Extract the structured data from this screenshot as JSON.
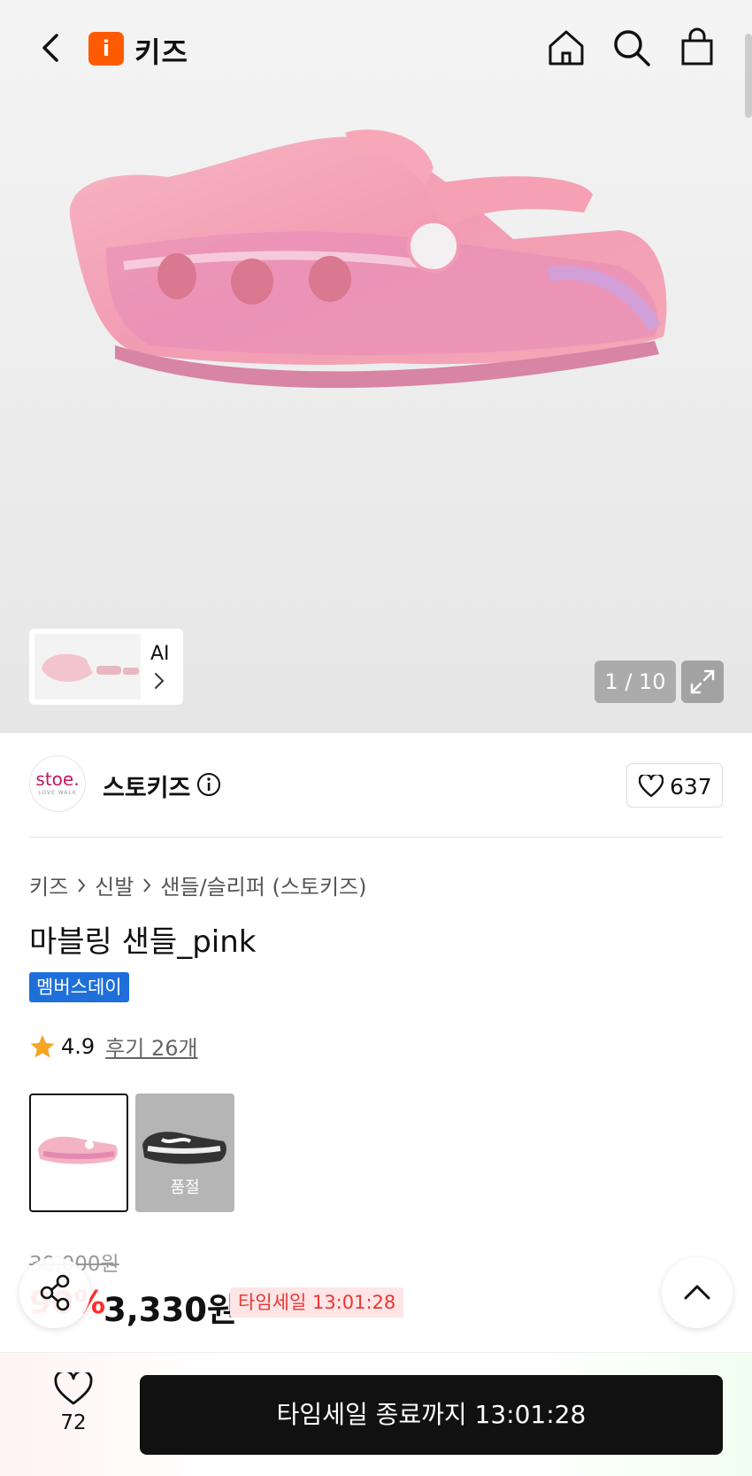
{
  "header": {
    "logo_text": "i",
    "title": "키즈",
    "icons": [
      "back-icon",
      "home-icon",
      "search-icon",
      "shopping-bag-icon"
    ]
  },
  "gallery": {
    "ai_label": "AI",
    "counter": "1 / 10"
  },
  "seller": {
    "logo_text": "stoe.",
    "logo_sub": "LOVE WALK",
    "name": "스토키즈",
    "likes": "637"
  },
  "breadcrumb": [
    "키즈",
    "신발",
    "샌들/슬리퍼 (스토키즈)"
  ],
  "product": {
    "title": "마블링 샌들_pink",
    "badge": "멤버스데이",
    "rating": "4.9",
    "reviews": "후기 26개",
    "soldout_label": "품절"
  },
  "price": {
    "original": "30,000원",
    "discount": "90%",
    "sale": "3,330원",
    "timesale_tag": "타임세일 13:01:28"
  },
  "bottom_bar": {
    "wish_count": "72",
    "cta": "타임세일 종료까지 13:01:28"
  },
  "colors": {
    "brand_orange": "#ff5a00",
    "badge_blue": "#1e6fd9",
    "discount_red": "#ff2d2d",
    "star_orange": "#f5a623",
    "cta_black": "#111111"
  }
}
